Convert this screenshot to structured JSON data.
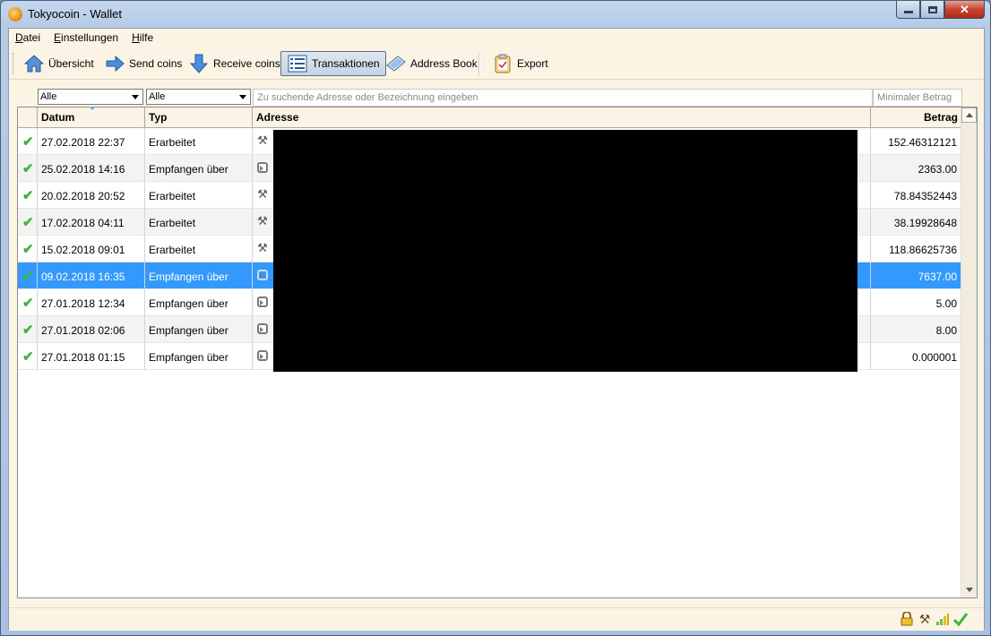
{
  "window": {
    "title": "Tokyocoin - Wallet"
  },
  "menu": [
    {
      "first": "D",
      "rest": "atei"
    },
    {
      "first": "E",
      "rest": "instellungen"
    },
    {
      "first": "H",
      "rest": "ilfe"
    }
  ],
  "toolbar": {
    "overview": "Übersicht",
    "send": "Send coins",
    "receive": "Receive coins",
    "transactions": "Transaktionen",
    "address_book": "Address Book",
    "export": "Export"
  },
  "filters": {
    "date_filter": "Alle",
    "type_filter": "Alle",
    "search_placeholder": "Zu suchende Adresse oder Bezeichnung eingeben",
    "min_amount_placeholder": "Minimaler Betrag"
  },
  "table": {
    "headers": {
      "date": "Datum",
      "type": "Typ",
      "address": "Adresse",
      "amount": "Betrag"
    },
    "rows": [
      {
        "status": "✔",
        "date": "27.02.2018 22:37",
        "type": "Erarbeitet",
        "amount": "152.46312121"
      },
      {
        "status": "✔",
        "date": "25.02.2018 14:16",
        "type": "Empfangen über",
        "amount": "2363.00"
      },
      {
        "status": "✔",
        "date": "20.02.2018 20:52",
        "type": "Erarbeitet",
        "amount": "78.84352443"
      },
      {
        "status": "✔",
        "date": "17.02.2018 04:11",
        "type": "Erarbeitet",
        "amount": "38.19928648"
      },
      {
        "status": "✔",
        "date": "15.02.2018 09:01",
        "type": "Erarbeitet",
        "amount": "118.86625736"
      },
      {
        "status": "✔",
        "date": "09.02.2018 16:35",
        "type": "Empfangen über",
        "amount": "7637.00"
      },
      {
        "status": "✔",
        "date": "27.01.2018 12:34",
        "type": "Empfangen über",
        "amount": "5.00"
      },
      {
        "status": "✔",
        "date": "27.01.2018 02:06",
        "type": "Empfangen über",
        "amount": "8.00"
      },
      {
        "status": "✔",
        "date": "27.01.2018 01:15",
        "type": "Empfangen über",
        "amount": "0.000001"
      }
    ]
  },
  "colors": {
    "selection": "#3399ff",
    "confirmed": "#3cb53c",
    "background": "#fbf4e4"
  }
}
